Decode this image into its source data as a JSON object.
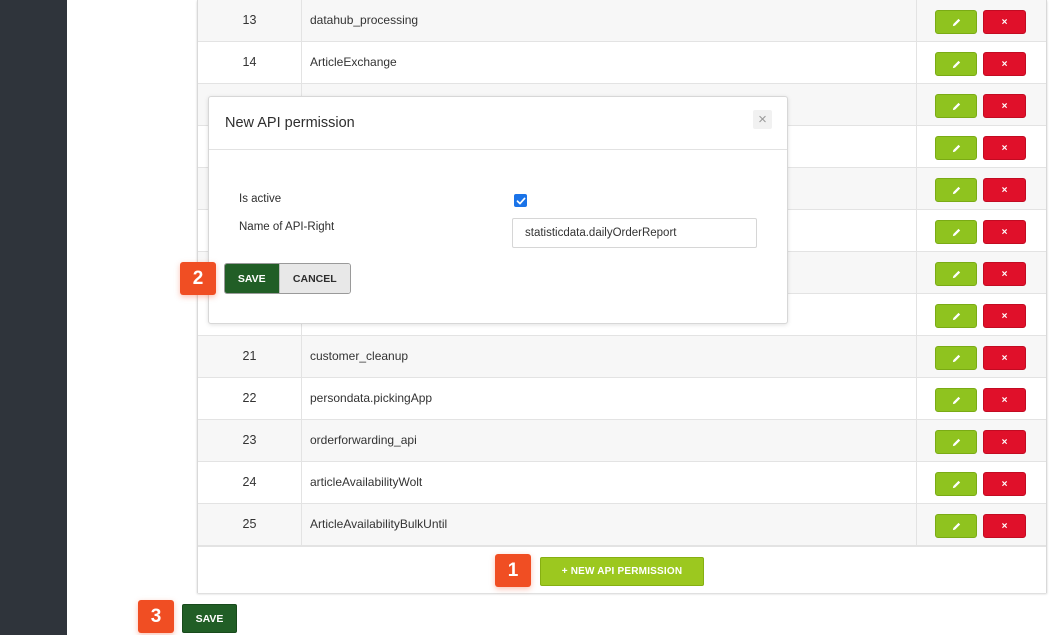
{
  "table": {
    "rows": [
      {
        "id": "13",
        "name": "datahub_processing"
      },
      {
        "id": "14",
        "name": "ArticleExchange"
      },
      {
        "id": "",
        "name": ""
      },
      {
        "id": "",
        "name": ""
      },
      {
        "id": "",
        "name": ""
      },
      {
        "id": "",
        "name": ""
      },
      {
        "id": "",
        "name": ""
      },
      {
        "id": "",
        "name": ""
      },
      {
        "id": "21",
        "name": "customer_cleanup"
      },
      {
        "id": "22",
        "name": "persondata.pickingApp"
      },
      {
        "id": "23",
        "name": "orderforwarding_api"
      },
      {
        "id": "24",
        "name": "articleAvailabilityWolt"
      },
      {
        "id": "25",
        "name": "ArticleAvailabilityBulkUntil"
      }
    ],
    "delete_label": "×",
    "new_button_label": "+ NEW API PERMISSION"
  },
  "modal": {
    "title": "New API permission",
    "close_label": "×",
    "is_active_label": "Is active",
    "is_active_checked": true,
    "name_label": "Name of API-Right",
    "name_value": "statisticdata.dailyOrderReport",
    "save_label": "SAVE",
    "cancel_label": "CANCEL"
  },
  "page": {
    "save_label": "SAVE"
  },
  "badges": {
    "one": "1",
    "two": "2",
    "three": "3"
  },
  "colors": {
    "edit": "#8fc31f",
    "delete": "#e0102a",
    "save": "#215e26",
    "badge": "#f04e23",
    "sidebar": "#2f343b"
  }
}
